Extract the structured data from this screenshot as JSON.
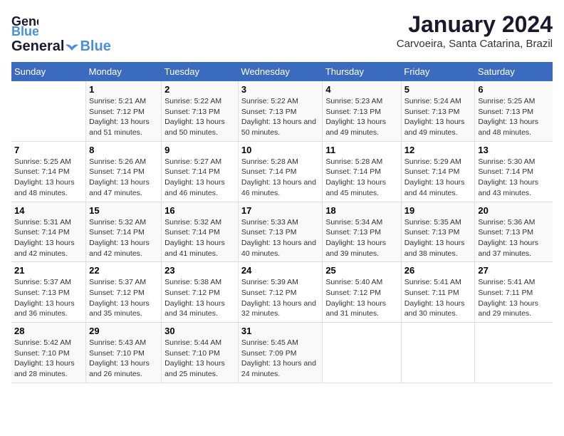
{
  "logo": {
    "text_general": "General",
    "text_blue": "Blue"
  },
  "title": "January 2024",
  "subtitle": "Carvoeira, Santa Catarina, Brazil",
  "days_of_week": [
    "Sunday",
    "Monday",
    "Tuesday",
    "Wednesday",
    "Thursday",
    "Friday",
    "Saturday"
  ],
  "weeks": [
    [
      {
        "day": "",
        "sunrise": "",
        "sunset": "",
        "daylight": ""
      },
      {
        "day": "1",
        "sunrise": "Sunrise: 5:21 AM",
        "sunset": "Sunset: 7:12 PM",
        "daylight": "Daylight: 13 hours and 51 minutes."
      },
      {
        "day": "2",
        "sunrise": "Sunrise: 5:22 AM",
        "sunset": "Sunset: 7:13 PM",
        "daylight": "Daylight: 13 hours and 50 minutes."
      },
      {
        "day": "3",
        "sunrise": "Sunrise: 5:22 AM",
        "sunset": "Sunset: 7:13 PM",
        "daylight": "Daylight: 13 hours and 50 minutes."
      },
      {
        "day": "4",
        "sunrise": "Sunrise: 5:23 AM",
        "sunset": "Sunset: 7:13 PM",
        "daylight": "Daylight: 13 hours and 49 minutes."
      },
      {
        "day": "5",
        "sunrise": "Sunrise: 5:24 AM",
        "sunset": "Sunset: 7:13 PM",
        "daylight": "Daylight: 13 hours and 49 minutes."
      },
      {
        "day": "6",
        "sunrise": "Sunrise: 5:25 AM",
        "sunset": "Sunset: 7:13 PM",
        "daylight": "Daylight: 13 hours and 48 minutes."
      }
    ],
    [
      {
        "day": "7",
        "sunrise": "Sunrise: 5:25 AM",
        "sunset": "Sunset: 7:14 PM",
        "daylight": "Daylight: 13 hours and 48 minutes."
      },
      {
        "day": "8",
        "sunrise": "Sunrise: 5:26 AM",
        "sunset": "Sunset: 7:14 PM",
        "daylight": "Daylight: 13 hours and 47 minutes."
      },
      {
        "day": "9",
        "sunrise": "Sunrise: 5:27 AM",
        "sunset": "Sunset: 7:14 PM",
        "daylight": "Daylight: 13 hours and 46 minutes."
      },
      {
        "day": "10",
        "sunrise": "Sunrise: 5:28 AM",
        "sunset": "Sunset: 7:14 PM",
        "daylight": "Daylight: 13 hours and 46 minutes."
      },
      {
        "day": "11",
        "sunrise": "Sunrise: 5:28 AM",
        "sunset": "Sunset: 7:14 PM",
        "daylight": "Daylight: 13 hours and 45 minutes."
      },
      {
        "day": "12",
        "sunrise": "Sunrise: 5:29 AM",
        "sunset": "Sunset: 7:14 PM",
        "daylight": "Daylight: 13 hours and 44 minutes."
      },
      {
        "day": "13",
        "sunrise": "Sunrise: 5:30 AM",
        "sunset": "Sunset: 7:14 PM",
        "daylight": "Daylight: 13 hours and 43 minutes."
      }
    ],
    [
      {
        "day": "14",
        "sunrise": "Sunrise: 5:31 AM",
        "sunset": "Sunset: 7:14 PM",
        "daylight": "Daylight: 13 hours and 42 minutes."
      },
      {
        "day": "15",
        "sunrise": "Sunrise: 5:32 AM",
        "sunset": "Sunset: 7:14 PM",
        "daylight": "Daylight: 13 hours and 42 minutes."
      },
      {
        "day": "16",
        "sunrise": "Sunrise: 5:32 AM",
        "sunset": "Sunset: 7:14 PM",
        "daylight": "Daylight: 13 hours and 41 minutes."
      },
      {
        "day": "17",
        "sunrise": "Sunrise: 5:33 AM",
        "sunset": "Sunset: 7:13 PM",
        "daylight": "Daylight: 13 hours and 40 minutes."
      },
      {
        "day": "18",
        "sunrise": "Sunrise: 5:34 AM",
        "sunset": "Sunset: 7:13 PM",
        "daylight": "Daylight: 13 hours and 39 minutes."
      },
      {
        "day": "19",
        "sunrise": "Sunrise: 5:35 AM",
        "sunset": "Sunset: 7:13 PM",
        "daylight": "Daylight: 13 hours and 38 minutes."
      },
      {
        "day": "20",
        "sunrise": "Sunrise: 5:36 AM",
        "sunset": "Sunset: 7:13 PM",
        "daylight": "Daylight: 13 hours and 37 minutes."
      }
    ],
    [
      {
        "day": "21",
        "sunrise": "Sunrise: 5:37 AM",
        "sunset": "Sunset: 7:13 PM",
        "daylight": "Daylight: 13 hours and 36 minutes."
      },
      {
        "day": "22",
        "sunrise": "Sunrise: 5:37 AM",
        "sunset": "Sunset: 7:12 PM",
        "daylight": "Daylight: 13 hours and 35 minutes."
      },
      {
        "day": "23",
        "sunrise": "Sunrise: 5:38 AM",
        "sunset": "Sunset: 7:12 PM",
        "daylight": "Daylight: 13 hours and 34 minutes."
      },
      {
        "day": "24",
        "sunrise": "Sunrise: 5:39 AM",
        "sunset": "Sunset: 7:12 PM",
        "daylight": "Daylight: 13 hours and 32 minutes."
      },
      {
        "day": "25",
        "sunrise": "Sunrise: 5:40 AM",
        "sunset": "Sunset: 7:12 PM",
        "daylight": "Daylight: 13 hours and 31 minutes."
      },
      {
        "day": "26",
        "sunrise": "Sunrise: 5:41 AM",
        "sunset": "Sunset: 7:11 PM",
        "daylight": "Daylight: 13 hours and 30 minutes."
      },
      {
        "day": "27",
        "sunrise": "Sunrise: 5:41 AM",
        "sunset": "Sunset: 7:11 PM",
        "daylight": "Daylight: 13 hours and 29 minutes."
      }
    ],
    [
      {
        "day": "28",
        "sunrise": "Sunrise: 5:42 AM",
        "sunset": "Sunset: 7:10 PM",
        "daylight": "Daylight: 13 hours and 28 minutes."
      },
      {
        "day": "29",
        "sunrise": "Sunrise: 5:43 AM",
        "sunset": "Sunset: 7:10 PM",
        "daylight": "Daylight: 13 hours and 26 minutes."
      },
      {
        "day": "30",
        "sunrise": "Sunrise: 5:44 AM",
        "sunset": "Sunset: 7:10 PM",
        "daylight": "Daylight: 13 hours and 25 minutes."
      },
      {
        "day": "31",
        "sunrise": "Sunrise: 5:45 AM",
        "sunset": "Sunset: 7:09 PM",
        "daylight": "Daylight: 13 hours and 24 minutes."
      },
      {
        "day": "",
        "sunrise": "",
        "sunset": "",
        "daylight": ""
      },
      {
        "day": "",
        "sunrise": "",
        "sunset": "",
        "daylight": ""
      },
      {
        "day": "",
        "sunrise": "",
        "sunset": "",
        "daylight": ""
      }
    ]
  ]
}
